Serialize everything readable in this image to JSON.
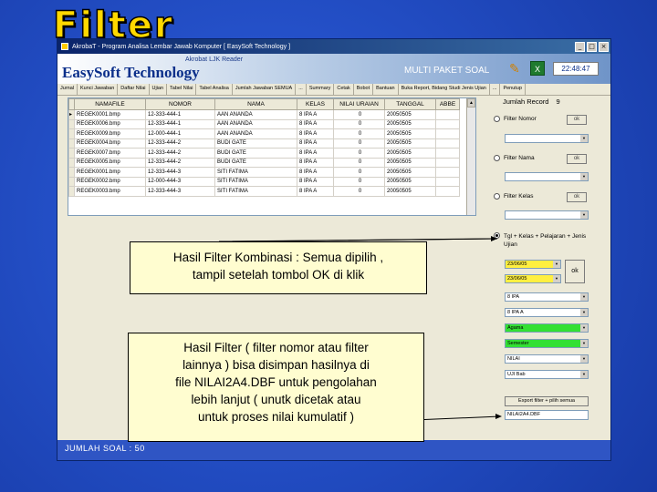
{
  "slide": {
    "title": "Filter"
  },
  "window": {
    "title": "AkrobaT - Program Analisa Lembar Jawab Komputer  [ EasySoft Technology ]",
    "controls": [
      "_",
      "□",
      "×"
    ]
  },
  "banner": {
    "subtitle": "Akrobat LJK Reader",
    "brand": "EasySoft Technology",
    "paket": "MULTI PAKET SOAL",
    "clock": "22:48:47"
  },
  "menu": [
    "Jurnal",
    "Kunci Jawaban",
    "Daftar Nilai",
    "Ujian",
    "Tabel Nilai",
    "Tabel Analisa",
    "Jumlah Jawaban SEMUA",
    "...",
    "Summary",
    "Cetak",
    "Bobot",
    "Bantuan",
    "Buka Report, Bidang Studi Jenis Ujian",
    "...",
    "Penutup"
  ],
  "grid": {
    "columns": [
      "NAMAFILE",
      "NOMOR",
      "NAMA",
      "KELAS",
      "NILAI URAIAN",
      "TANGGAL",
      "ABBE"
    ],
    "rows": [
      [
        "REGEK0001.bmp",
        "12-333-444-1",
        "AAN ANANDA",
        "8 IPA A",
        "0",
        "20050505",
        ""
      ],
      [
        "REGEK0006.bmp",
        "12-333-444-1",
        "AAN ANANDA",
        "8 IPA A",
        "0",
        "20050505",
        ""
      ],
      [
        "REGEK0009.bmp",
        "12-000-444-1",
        "AAN ANANDA",
        "8 IPA A",
        "0",
        "20050505",
        ""
      ],
      [
        "REGEK0004.bmp",
        "12-333-444-2",
        "BUDI GATE",
        "8 IPA A",
        "0",
        "20050505",
        ""
      ],
      [
        "REGEK0007.bmp",
        "12-333-444-2",
        "BUDI GATE",
        "8 IPA A",
        "0",
        "20050505",
        ""
      ],
      [
        "REGEK0005.bmp",
        "12-333-444-2",
        "BUDI GATE",
        "8 IPA A",
        "0",
        "20050505",
        ""
      ],
      [
        "REGEK0001.bmp",
        "12-333-444-3",
        "SITI FATIMA",
        "8 IPA A",
        "0",
        "20050505",
        ""
      ],
      [
        "REGEK0002.bmp",
        "12-000-444-3",
        "SITI FATIMA",
        "8 IPA A",
        "0",
        "20050505",
        ""
      ],
      [
        "REGEK0003.bmp",
        "12-333-444-3",
        "SITI FATIMA",
        "8 IPA A",
        "0",
        "20050505",
        ""
      ]
    ]
  },
  "panel": {
    "record_label": "Jumlah Record",
    "record_count": "9",
    "filter_nomor": "Filter Nomor",
    "filter_nama": "Filter Nama",
    "filter_kelas": "Filter Kelas",
    "ok": "ok",
    "kombinasi_label": "Tgl + Kelas + Pelajaran + Jenis Ujian",
    "date1": "23/06/05",
    "date2": "23/06/05",
    "kelas_value": "8 IPA",
    "kelas2_value": "8 IPA A",
    "pelajaran_value": "Agama",
    "jenis_value": "Semester",
    "extra_value": "NILAI",
    "bidang_value": "UJI Bab",
    "export_label": "Export filter + pilih semua",
    "export_file": "NILAI2A4.DBF"
  },
  "status": {
    "text": "JUMLAH SOAL : 50"
  },
  "callouts": {
    "c1_line1": "Hasil Filter Kombinasi : Semua dipilih ,",
    "c1_line2": "tampil setelah tombol OK di klik",
    "c2_line1": "Hasil Filter ( filter nomor atau filter",
    "c2_line2": "lainnya ) bisa disimpan hasilnya di",
    "c2_line3": "file NILAI2A4.DBF untuk pengolahan",
    "c2_line4": "lebih lanjut ( unutk dicetak atau",
    "c2_line5": "untuk proses nilai kumulatif )"
  }
}
